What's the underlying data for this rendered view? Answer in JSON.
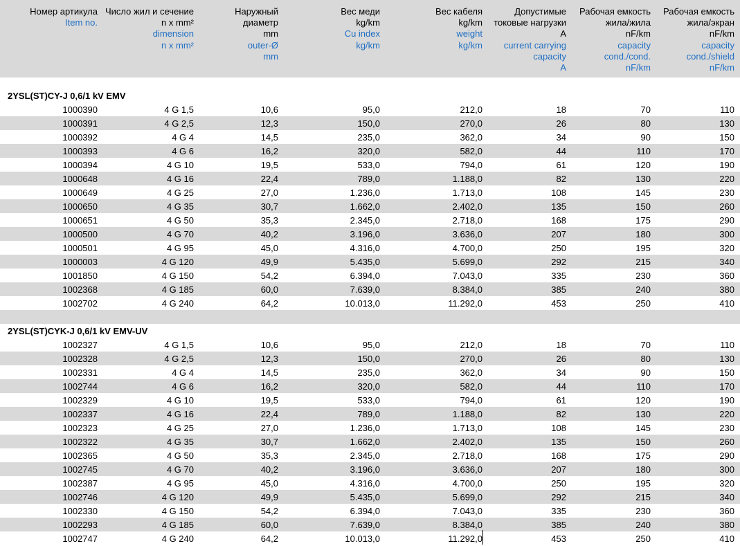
{
  "headers": [
    {
      "ru": [
        "Номер артикула"
      ],
      "en": [
        "Item no."
      ]
    },
    {
      "ru": [
        "Число жил и сечение",
        "n x mm²"
      ],
      "en": [
        "dimension",
        "n x mm²"
      ]
    },
    {
      "ru": [
        "Наружный",
        "диаметр",
        "mm"
      ],
      "en": [
        "outer-Ø",
        "mm"
      ]
    },
    {
      "ru": [
        "Вес меди",
        "kg/km"
      ],
      "en": [
        "Cu index",
        "kg/km"
      ]
    },
    {
      "ru": [
        "Вес кабеля",
        "kg/km"
      ],
      "en": [
        "weight",
        "kg/km"
      ]
    },
    {
      "ru": [
        "Допустимые",
        "токовые нагрузки",
        "A"
      ],
      "en": [
        "current carrying",
        "capacity",
        "A"
      ]
    },
    {
      "ru": [
        "Рабочая емкость",
        "жила/жила",
        "nF/km"
      ],
      "en": [
        "capacity",
        "cond./cond.",
        "nF/km"
      ]
    },
    {
      "ru": [
        "Рабочая емкость",
        "жила/экран",
        "nF/km"
      ],
      "en": [
        "capacity",
        "cond./shield",
        "nF/km"
      ]
    }
  ],
  "sections": [
    {
      "title": "2YSL(ST)CY-J 0,6/1 kV EMV",
      "rows": [
        [
          "1000390",
          "4 G 1,5",
          "10,6",
          "95,0",
          "212,0",
          "18",
          "70",
          "110"
        ],
        [
          "1000391",
          "4 G 2,5",
          "12,3",
          "150,0",
          "270,0",
          "26",
          "80",
          "130"
        ],
        [
          "1000392",
          "4 G 4",
          "14,5",
          "235,0",
          "362,0",
          "34",
          "90",
          "150"
        ],
        [
          "1000393",
          "4 G 6",
          "16,2",
          "320,0",
          "582,0",
          "44",
          "110",
          "170"
        ],
        [
          "1000394",
          "4 G 10",
          "19,5",
          "533,0",
          "794,0",
          "61",
          "120",
          "190"
        ],
        [
          "1000648",
          "4 G 16",
          "22,4",
          "789,0",
          "1.188,0",
          "82",
          "130",
          "220"
        ],
        [
          "1000649",
          "4 G 25",
          "27,0",
          "1.236,0",
          "1.713,0",
          "108",
          "145",
          "230"
        ],
        [
          "1000650",
          "4 G 35",
          "30,7",
          "1.662,0",
          "2.402,0",
          "135",
          "150",
          "260"
        ],
        [
          "1000651",
          "4 G 50",
          "35,3",
          "2.345,0",
          "2.718,0",
          "168",
          "175",
          "290"
        ],
        [
          "1000500",
          "4 G 70",
          "40,2",
          "3.196,0",
          "3.636,0",
          "207",
          "180",
          "300"
        ],
        [
          "1000501",
          "4 G 95",
          "45,0",
          "4.316,0",
          "4.700,0",
          "250",
          "195",
          "320"
        ],
        [
          "1000003",
          "4 G 120",
          "49,9",
          "5.435,0",
          "5.699,0",
          "292",
          "215",
          "340"
        ],
        [
          "1001850",
          "4 G 150",
          "54,2",
          "6.394,0",
          "7.043,0",
          "335",
          "230",
          "360"
        ],
        [
          "1002368",
          "4 G 185",
          "60,0",
          "7.639,0",
          "8.384,0",
          "385",
          "240",
          "380"
        ],
        [
          "1002702",
          "4 G 240",
          "64,2",
          "10.013,0",
          "11.292,0",
          "453",
          "250",
          "410"
        ]
      ]
    },
    {
      "title": "2YSL(ST)CYK-J 0,6/1 kV EMV-UV",
      "rows": [
        [
          "1002327",
          "4 G 1,5",
          "10,6",
          "95,0",
          "212,0",
          "18",
          "70",
          "110"
        ],
        [
          "1002328",
          "4 G 2,5",
          "12,3",
          "150,0",
          "270,0",
          "26",
          "80",
          "130"
        ],
        [
          "1002331",
          "4 G 4",
          "14,5",
          "235,0",
          "362,0",
          "34",
          "90",
          "150"
        ],
        [
          "1002744",
          "4 G 6",
          "16,2",
          "320,0",
          "582,0",
          "44",
          "110",
          "170"
        ],
        [
          "1002329",
          "4 G 10",
          "19,5",
          "533,0",
          "794,0",
          "61",
          "120",
          "190"
        ],
        [
          "1002337",
          "4 G 16",
          "22,4",
          "789,0",
          "1.188,0",
          "82",
          "130",
          "220"
        ],
        [
          "1002323",
          "4 G 25",
          "27,0",
          "1.236,0",
          "1.713,0",
          "108",
          "145",
          "230"
        ],
        [
          "1002322",
          "4 G 35",
          "30,7",
          "1.662,0",
          "2.402,0",
          "135",
          "150",
          "260"
        ],
        [
          "1002365",
          "4 G 50",
          "35,3",
          "2.345,0",
          "2.718,0",
          "168",
          "175",
          "290"
        ],
        [
          "1002745",
          "4 G 70",
          "40,2",
          "3.196,0",
          "3.636,0",
          "207",
          "180",
          "300"
        ],
        [
          "1002387",
          "4 G 95",
          "45,0",
          "4.316,0",
          "4.700,0",
          "250",
          "195",
          "320"
        ],
        [
          "1002746",
          "4 G 120",
          "49,9",
          "5.435,0",
          "5.699,0",
          "292",
          "215",
          "340"
        ],
        [
          "1002330",
          "4 G 150",
          "54,2",
          "6.394,0",
          "7.043,0",
          "335",
          "230",
          "360"
        ],
        [
          "1002293",
          "4 G 185",
          "60,0",
          "7.639,0",
          "8.384,0",
          "385",
          "240",
          "380"
        ],
        [
          "1002747",
          "4 G 240",
          "64,2",
          "10.013,0",
          "11.292,0",
          "453",
          "250",
          "410"
        ]
      ]
    }
  ]
}
